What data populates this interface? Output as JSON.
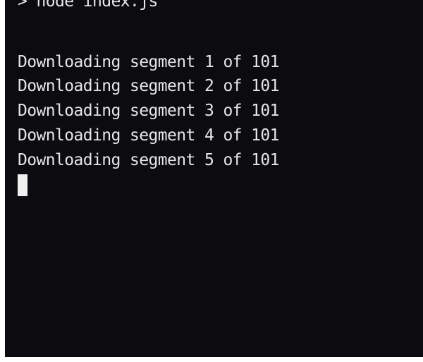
{
  "terminal": {
    "command_line": "> node index.js",
    "output_lines": [
      "Downloading segment 1 of 101",
      "Downloading segment 2 of 101",
      "Downloading segment 3 of 101",
      "Downloading segment 4 of 101",
      "Downloading segment 5 of 101"
    ],
    "colors": {
      "background": "#0c0c10",
      "text": "#e6e6e6",
      "cursor": "#f0f0f0"
    }
  }
}
